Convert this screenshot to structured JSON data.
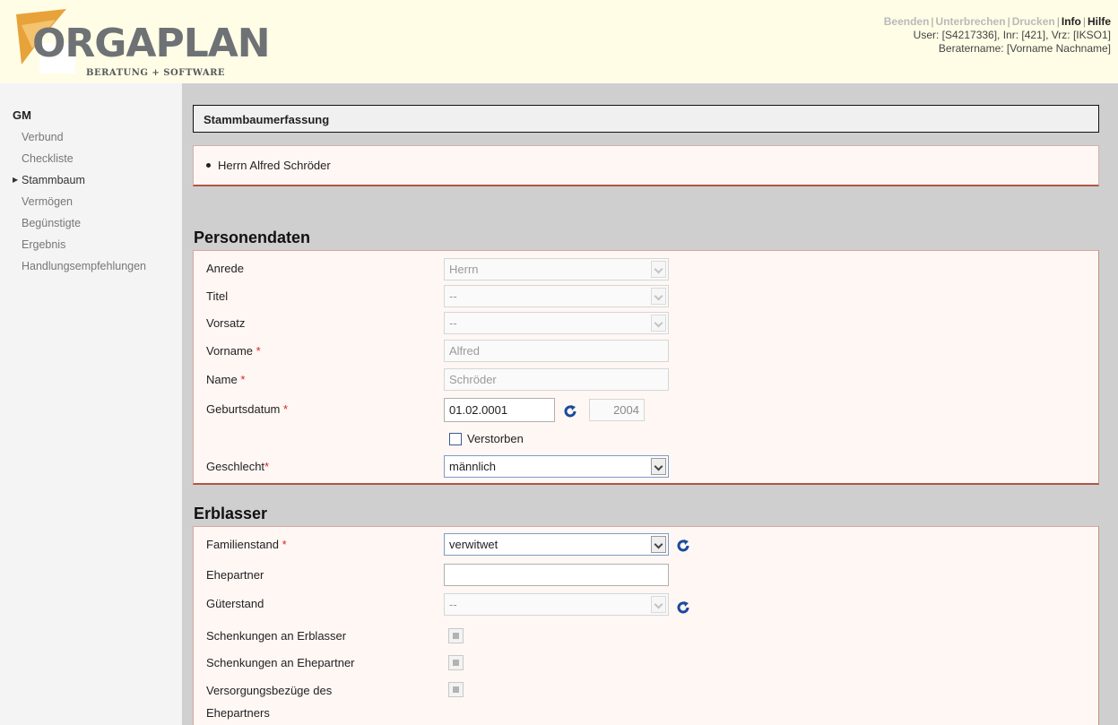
{
  "header": {
    "logo_text": "ORGAPLAN",
    "logo_sub": "BERATUNG + SOFTWARE",
    "links": {
      "beenden": "Beenden",
      "unterbrechen": "Unterbrechen",
      "drucken": "Drucken",
      "info": "Info",
      "hilfe": "Hilfe"
    },
    "user_line": "User: [S4217336], Inr: [421], Vrz: [IKSO1]",
    "berater_line": "Beratername: [Vorname Nachname]"
  },
  "sidebar": {
    "title": "GM",
    "items": [
      {
        "label": "Verbund"
      },
      {
        "label": "Checkliste"
      },
      {
        "label": "Stammbaum"
      },
      {
        "label": "Vermögen"
      },
      {
        "label": "Begünstigte"
      },
      {
        "label": "Ergebnis"
      },
      {
        "label": "Handlungsempfehlungen"
      }
    ]
  },
  "page_title": "Stammbaumerfassung",
  "person": "Herrn Alfred Schröder",
  "personendaten": {
    "title": "Personendaten",
    "anrede": {
      "label": "Anrede",
      "value": "Herrn"
    },
    "titel": {
      "label": "Titel",
      "value": "--"
    },
    "vorsatz": {
      "label": "Vorsatz",
      "value": "--"
    },
    "vorname": {
      "label": "Vorname",
      "value": "Alfred"
    },
    "name": {
      "label": "Name",
      "value": "Schröder"
    },
    "geburtsdatum": {
      "label": "Geburtsdatum",
      "value": "01.02.0001",
      "year": "2004"
    },
    "verstorben": {
      "label": "Verstorben"
    },
    "geschlecht": {
      "label": "Geschlecht",
      "value": "männlich"
    },
    "required_mark": "*"
  },
  "erblasser": {
    "title": "Erblasser",
    "familienstand": {
      "label": "Familienstand",
      "value": "verwitwet"
    },
    "ehepartner": {
      "label": "Ehepartner",
      "value": ""
    },
    "gueterstand": {
      "label": "Güterstand",
      "value": "--"
    },
    "schenkungen_erblasser": {
      "label": "Schenkungen an Erblasser"
    },
    "schenkungen_ehepartner": {
      "label": "Schenkungen an Ehepartner"
    },
    "versorgung_line1": "Versorgungsbezüge des",
    "versorgung_line2": "Ehepartners"
  },
  "colors": {
    "header_bg": "#fffde6",
    "content_bg": "#cfcfcf",
    "section_border": "#b05545",
    "refresh_icon": "#1a4a9c",
    "logo_orange": "#e8a23a"
  }
}
